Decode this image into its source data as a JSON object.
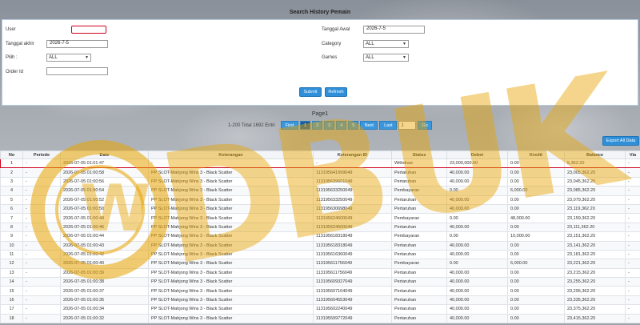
{
  "page_title": "Search History Pemain",
  "form": {
    "user_label": "User",
    "user_value": "",
    "tanggal_akhir_label": "Tanggal akhir",
    "tanggal_akhir_value": "2026-7-5",
    "pilih_label": "Pilih :",
    "pilih_value": "ALL",
    "order_id_label": "Order Id",
    "order_id_value": "",
    "tanggal_awal_label": "Tanggal Awal",
    "tanggal_awal_value": "2026-7-5",
    "category_label": "Category",
    "category_value": "ALL",
    "games_label": "Games",
    "games_value": "ALL",
    "submit_label": "Submit",
    "refresh_label": "Refresh"
  },
  "pagination": {
    "page_label": "Page1",
    "total_text": "1-200 Total 1692 Entri",
    "first": "First",
    "pages": [
      "1",
      "2",
      "3",
      "4",
      "5"
    ],
    "next": "Next",
    "last": "Last",
    "goto_value": "1",
    "go": "Go"
  },
  "export_label": "Export All Data",
  "table": {
    "headers": [
      "No",
      "Periode",
      "Date",
      "Keterangan",
      "Keterangan ID",
      "Status",
      "Debet",
      "Kredit",
      "Balance",
      "Via"
    ],
    "rows": [
      [
        "1",
        "-",
        "2026-07-05 01:01:47",
        "-",
        "-",
        "Withdraw",
        "23,000,000.00",
        "0.00",
        "5,362.20",
        "-"
      ],
      [
        "2",
        "-",
        "2026-07-05 01:00:58",
        "PP SLOT-Mahjong Wins 3 - Black Scatter",
        "113195641999049",
        "Pertaruhan",
        "40,000.00",
        "0.00",
        "23,005,362.20",
        "-"
      ],
      [
        "3",
        "-",
        "2026-07-05 01:00:56",
        "PP SLOT-Mahjong Wins 3 - Black Scatter",
        "113195639601049",
        "Pertaruhan",
        "40,000.00",
        "0.00",
        "23,045,362.20",
        "-"
      ],
      [
        "4",
        "-",
        "2026-07-05 01:00:54",
        "PP SLOT-Mahjong Wins 3 - Black Scatter",
        "113195633250049",
        "Pembayaran",
        "0.00",
        "6,000.00",
        "23,085,362.20",
        "-"
      ],
      [
        "5",
        "-",
        "2026-07-05 01:00:52",
        "PP SLOT-Mahjong Wins 3 - Black Scatter",
        "113195633250049",
        "Pertaruhan",
        "40,000.00",
        "0.00",
        "23,079,362.20",
        "-"
      ],
      [
        "6",
        "-",
        "2026-07-05 01:00:50",
        "PP SLOT-Mahjong Wins 3 - Black Scatter",
        "113195630698049",
        "Pertaruhan",
        "40,000.00",
        "0.00",
        "23,119,362.20",
        "-"
      ],
      [
        "7",
        "-",
        "2026-07-05 01:00:48",
        "PP SLOT-Mahjong Wins 3 - Black Scatter",
        "113195624600049",
        "Pembayaran",
        "0.00",
        "48,000.00",
        "23,159,362.20",
        "-"
      ],
      [
        "8",
        "-",
        "2026-07-05 01:00:46",
        "PP SLOT-Mahjong Wins 3 - Black Scatter",
        "113195624600049",
        "Pertaruhan",
        "40,000.00",
        "0.00",
        "23,111,362.20",
        "-"
      ],
      [
        "9",
        "-",
        "2026-07-05 01:00:44",
        "PP SLOT-Mahjong Wins 3 - Black Scatter",
        "113195618318049",
        "Pembayaran",
        "0.00",
        "10,000.00",
        "23,151,362.20",
        "-"
      ],
      [
        "10",
        "-",
        "2026-07-05 01:00:43",
        "PP SLOT-Mahjong Wins 3 - Black Scatter",
        "113195618318049",
        "Pertaruhan",
        "40,000.00",
        "0.00",
        "23,141,362.20",
        "-"
      ],
      [
        "11",
        "-",
        "2026-07-05 01:00:42",
        "PP SLOT-Mahjong Wins 3 - Black Scatter",
        "113195616360049",
        "Pertaruhan",
        "40,000.00",
        "0.00",
        "23,181,362.20",
        "-"
      ],
      [
        "12",
        "-",
        "2026-07-05 01:00:40",
        "PP SLOT-Mahjong Wins 3 - Black Scatter",
        "113195611756049",
        "Pembayaran",
        "0.00",
        "6,000.00",
        "23,221,362.20",
        "-"
      ],
      [
        "13",
        "-",
        "2026-07-05 01:00:39",
        "PP SLOT-Mahjong Wins 3 - Black Scatter",
        "113195611756049",
        "Pertaruhan",
        "40,000.00",
        "0.00",
        "23,215,362.20",
        "-"
      ],
      [
        "14",
        "-",
        "2026-07-05 01:00:38",
        "PP SLOT-Mahjong Wins 3 - Black Scatter",
        "113195609327049",
        "Pertaruhan",
        "40,000.00",
        "0.00",
        "23,255,362.20",
        "-"
      ],
      [
        "15",
        "-",
        "2026-07-05 01:00:37",
        "PP SLOT-Mahjong Wins 3 - Black Scatter",
        "113195607164049",
        "Pertaruhan",
        "40,000.00",
        "0.00",
        "23,295,362.20",
        "-"
      ],
      [
        "16",
        "-",
        "2026-07-05 01:00:35",
        "PP SLOT-Mahjong Wins 3 - Black Scatter",
        "113195604553049",
        "Pertaruhan",
        "40,000.00",
        "0.00",
        "23,335,362.20",
        "-"
      ],
      [
        "17",
        "-",
        "2026-07-05 01:00:34",
        "PP SLOT-Mahjong Wins 3 - Black Scatter",
        "113195602240049",
        "Pertaruhan",
        "40,000.00",
        "0.00",
        "23,375,362.20",
        "-"
      ],
      [
        "18",
        "-",
        "2026-07-05 01:00:32",
        "PP SLOT-Mahjong Wins 3 - Black Scatter",
        "113195599772049",
        "Pertaruhan",
        "40,000.00",
        "0.00",
        "23,415,362.20",
        "-"
      ]
    ]
  },
  "watermark": {
    "text": "WDBUK",
    "color": "#e8a400"
  },
  "colors": {
    "accent": "#2f8fd8",
    "highlight_red": "#d0021b",
    "link": "#2a7fd4"
  }
}
